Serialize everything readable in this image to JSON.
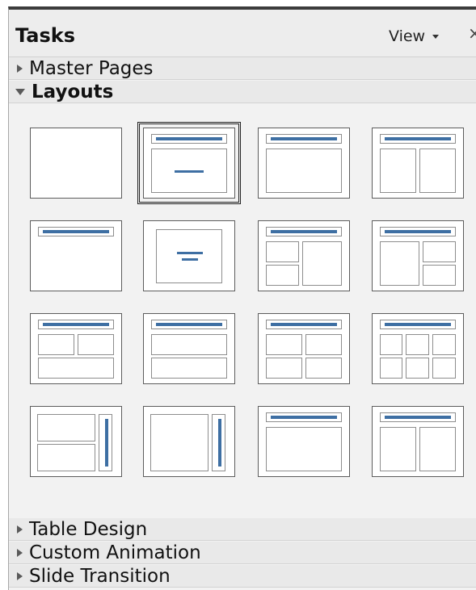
{
  "panel": {
    "title": "Tasks",
    "view_label": "View",
    "close_glyph": "×"
  },
  "sections": {
    "master_pages": "Master Pages",
    "layouts": "Layouts",
    "table_design": "Table Design",
    "custom_animation": "Custom Animation",
    "slide_transition": "Slide Transition"
  },
  "layouts": [
    {
      "layout": "blank",
      "selected": false
    },
    {
      "layout": "title-slide",
      "selected": true
    },
    {
      "layout": "title-content",
      "selected": false
    },
    {
      "layout": "title-2-content",
      "selected": false
    },
    {
      "layout": "title-only",
      "selected": false
    },
    {
      "layout": "centered-text",
      "selected": false
    },
    {
      "layout": "title-2-content-and-content",
      "selected": false
    },
    {
      "layout": "title-content-and-2-content",
      "selected": false
    },
    {
      "layout": "title-2-content-over-content",
      "selected": false
    },
    {
      "layout": "title-content-over-content",
      "selected": false
    },
    {
      "layout": "title-4-content",
      "selected": false
    },
    {
      "layout": "title-6-content",
      "selected": false
    },
    {
      "layout": "vertical-title-vertical-text-2-content",
      "selected": false
    },
    {
      "layout": "vertical-title-vertical-text",
      "selected": false
    },
    {
      "layout": "title-vertical-text",
      "selected": false
    },
    {
      "layout": "title-vertical-text-2-content",
      "selected": false
    }
  ],
  "colors": {
    "placeholder_bar": "#3e6fa3"
  }
}
